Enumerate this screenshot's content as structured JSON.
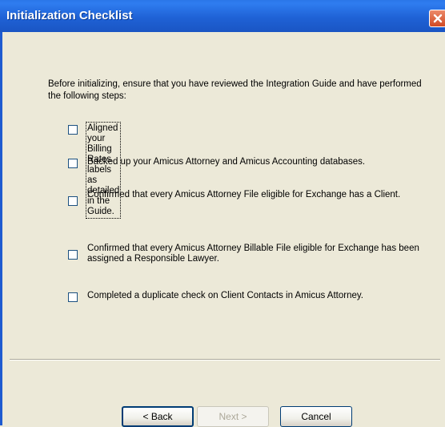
{
  "window": {
    "title": "Initialization Checklist"
  },
  "intro_text": "Before initializing, ensure that you have reviewed the Integration Guide and have performed the following steps:",
  "checklist": [
    {
      "label": "Aligned your Billing Rates labels as detailed in the Guide.",
      "checked": false
    },
    {
      "label": "Backed up your Amicus Attorney and Amicus Accounting databases.",
      "checked": false
    },
    {
      "label": "Confirmed that every Amicus Attorney File eligible for Exchange has a Client.",
      "checked": false
    },
    {
      "label": "Confirmed that every Amicus Attorney Billable File eligible for Exchange has been assigned a Responsible Lawyer.",
      "checked": false
    },
    {
      "label": "Completed a duplicate check on Client Contacts in Amicus Attorney.",
      "checked": false
    }
  ],
  "buttons": {
    "back_label": "< Back",
    "next_label": "Next >",
    "cancel_label": "Cancel"
  },
  "colors": {
    "titlebar": "#1f62d6",
    "dialog_bg": "#ece9d8",
    "close_button": "#d04a24"
  }
}
